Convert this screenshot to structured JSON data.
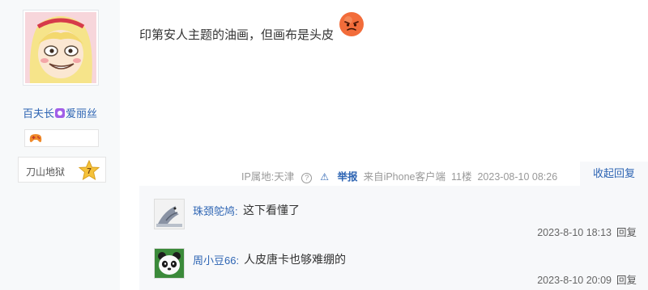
{
  "user": {
    "name_part1": "百夫长",
    "name_part2": "爱丽丝",
    "level_name": "刀山地狱",
    "level_num": "7"
  },
  "post": {
    "content": "印第安人主题的油画，但画布是头皮"
  },
  "meta": {
    "ip": "IP属地:天津",
    "help": "?",
    "report": "举报",
    "source": "来自iPhone客户端",
    "floor": "11楼",
    "time": "2023-08-10 08:26",
    "collapse": "收起回复"
  },
  "replies": [
    {
      "name": "珠颈鸵鸠:",
      "text": "这下看懂了",
      "time": "2023-8-10 18:13",
      "action": "回复"
    },
    {
      "name": "周小豆66:",
      "text": "人皮唐卡也够难绷的",
      "time": "2023-8-10 20:09",
      "action": "回复"
    }
  ],
  "colors": {
    "link": "#2d64b3",
    "vip": "#a25fe8",
    "panel": "#f7f8fa"
  }
}
